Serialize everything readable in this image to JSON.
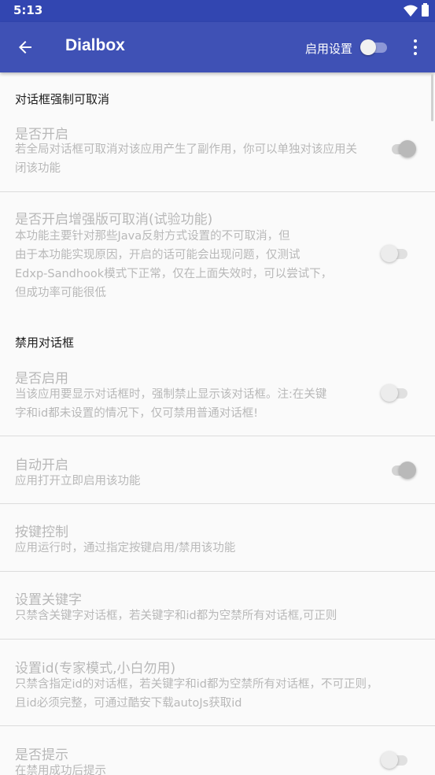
{
  "status_bar": {
    "time": "5:13"
  },
  "app_bar": {
    "title": "Dialbox",
    "enable_label": "启用设置",
    "enable_on": false
  },
  "sections": {
    "cancelable": {
      "header": "对话框强制可取消"
    },
    "disable": {
      "header": "禁用对话框"
    }
  },
  "prefs": {
    "enable_cancel": {
      "title": "是否开启",
      "summary": "若全局对话框可取消对该应用产生了副作用，你可以单独对该应用关闭该功能",
      "on": true
    },
    "enhanced_cancel": {
      "title": "是否开启增强版可取消(试验功能)",
      "summary_lines": [
        "本功能主要针对那些Java反射方式设置的不可取消，但",
        "由于本功能实现原因，开启的话可能会出现问题，仅测试",
        "Edxp-Sandhook模式下正常，仅在上面失效时，可以尝试下，",
        "但成功率可能很低"
      ],
      "on": false
    },
    "enable_disable": {
      "title": "是否启用",
      "summary_lines": [
        "当该应用要显示对话框时，强制禁止显示该对话框。注:在关键",
        "字和id都未设置的情况下，仅可禁用普通对话框!"
      ],
      "on": false
    },
    "auto_start": {
      "title": "自动开启",
      "summary": "应用打开立即启用该功能",
      "on": true
    },
    "key_control": {
      "title": "按键控制",
      "summary": "应用运行时，通过指定按键启用/禁用该功能"
    },
    "set_keyword": {
      "title": "设置关键字",
      "summary": "只禁含关键字对话框，若关键字和id都为空禁所有对话框,可正则"
    },
    "set_id": {
      "title": "设置id(专家模式,小白勿用)",
      "summary_lines": [
        "只禁含指定id的对话框，若关键字和id都为空禁所有对话框，不可正则，",
        "且id必须完整，可通过酷安下载autoJs获取id"
      ]
    },
    "show_tip": {
      "title": "是否提示",
      "summary": "在禁用成功后提示",
      "on": false
    }
  }
}
